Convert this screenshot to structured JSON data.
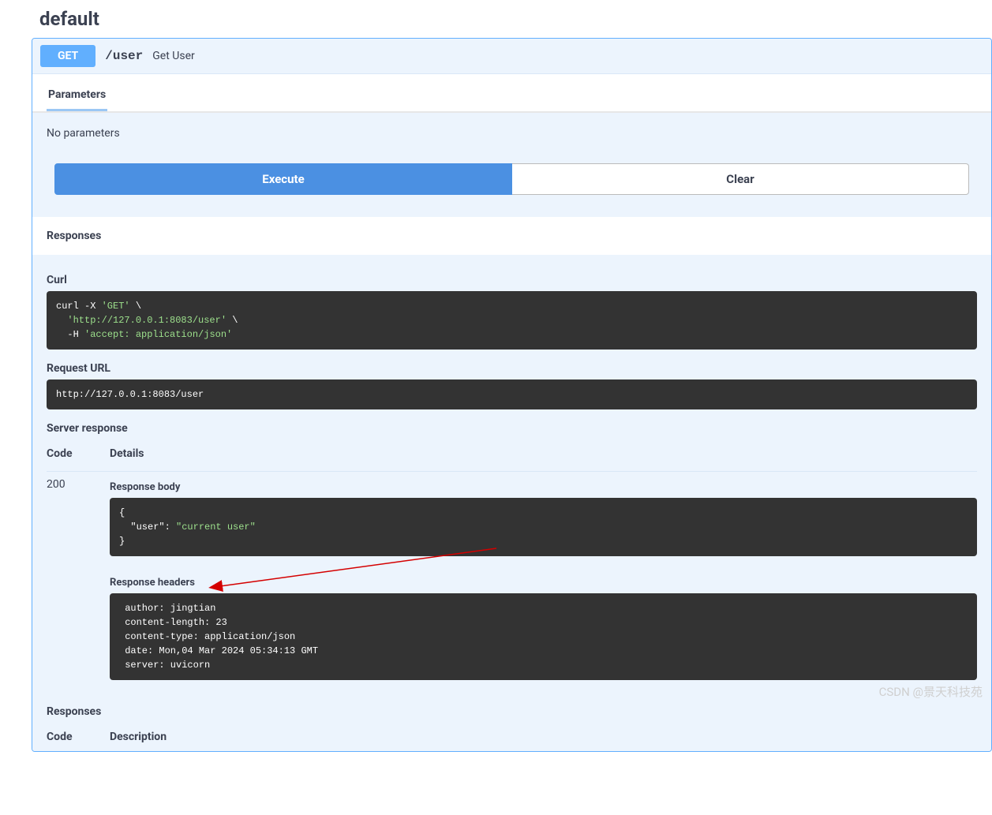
{
  "page": {
    "section_title": "default"
  },
  "endpoint": {
    "method": "GET",
    "path": "/user",
    "summary": "Get User"
  },
  "tabs": {
    "parameters": "Parameters"
  },
  "parameters": {
    "none_text": "No parameters"
  },
  "buttons": {
    "execute": "Execute",
    "clear": "Clear"
  },
  "responses_label": "Responses",
  "curl": {
    "label": "Curl",
    "line1_a": "curl -X ",
    "line1_b": "'GET'",
    "line1_c": " \\",
    "line2_a": "  ",
    "line2_b": "'http://127.0.0.1:8083/user'",
    "line2_c": " \\",
    "line3_a": "  -H ",
    "line3_b": "'accept: application/json'"
  },
  "request_url": {
    "label": "Request URL",
    "value": "http://127.0.0.1:8083/user"
  },
  "server_response": {
    "label": "Server response",
    "col_code": "Code",
    "col_details": "Details",
    "code": "200",
    "response_body_label": "Response body",
    "response_body_open": "{",
    "response_body_key": "  \"user\"",
    "response_body_colon": ": ",
    "response_body_val": "\"current user\"",
    "response_body_close": "}",
    "response_headers_label": "Response headers",
    "response_headers_text": " author: jingtian \n content-length: 23 \n content-type: application/json \n date: Mon,04 Mar 2024 05:34:13 GMT \n server: uvicorn "
  },
  "responses2": {
    "label": "Responses",
    "col_code": "Code",
    "col_desc": "Description"
  },
  "watermark": "CSDN @景天科技苑"
}
